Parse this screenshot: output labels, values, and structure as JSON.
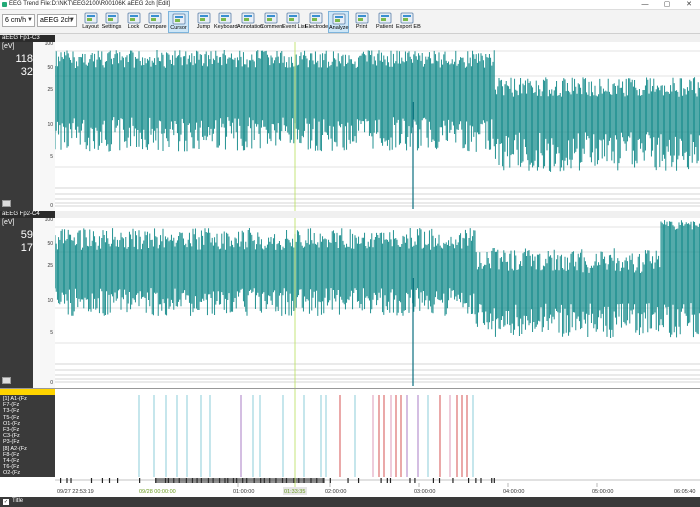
{
  "window": {
    "title": "EEG Trend File:D:\\NKT\\EEG2100\\R00106K aEEG 2ch [Edit]",
    "controls": [
      "—",
      "▢",
      "✕"
    ]
  },
  "toolbar": {
    "speed_select": "6 cm/h",
    "montage_select": "aEEG 2ch",
    "buttons": [
      {
        "label": "Layout",
        "icon": "layout-icon"
      },
      {
        "label": "Settings",
        "icon": "settings-icon"
      },
      {
        "label": "Lock",
        "icon": "lock-icon"
      },
      {
        "label": "Compare",
        "icon": "compare-icon"
      },
      {
        "label": "Cursor",
        "icon": "cursor-icon",
        "active": true
      },
      {
        "label": "Jump",
        "icon": "jump-icon"
      },
      {
        "label": "Keyboard",
        "icon": "keyboard-icon"
      },
      {
        "label": "Annotation",
        "icon": "annotation-icon"
      },
      {
        "label": "Comment",
        "icon": "comment-icon"
      },
      {
        "label": "Event List",
        "icon": "event-list-icon"
      },
      {
        "label": "Electrode",
        "icon": "electrode-icon"
      },
      {
        "label": "Analyze",
        "icon": "analyze-icon",
        "active": true
      },
      {
        "label": "Print",
        "icon": "print-icon"
      },
      {
        "label": "Patient",
        "icon": "patient-icon"
      },
      {
        "label": "Export EB",
        "icon": "export-icon"
      }
    ]
  },
  "channels": [
    {
      "name": "aEEG Fp1-C3",
      "unit": "[eV]",
      "upper_value": "118",
      "lower_value": "32",
      "scale_ticks": [
        "100",
        "50",
        "25",
        "10",
        "5",
        "0"
      ]
    },
    {
      "name": "aEEG Fp2-C4",
      "unit": "[eV]",
      "upper_value": "59",
      "lower_value": "17",
      "scale_ticks": [
        "100",
        "50",
        "25",
        "10",
        "5",
        "0"
      ]
    }
  ],
  "events": {
    "header": "",
    "labels": [
      "[1] A1-(Fz",
      "F7-(Fz",
      "T3-(Fz",
      "T5-(Fz",
      "O1-(Fz",
      "F3-(Fz",
      "C3-(Fz",
      "P3-(Fz",
      "[8] A2-(Fz",
      "F8-(Fz",
      "T4-(Fz",
      "T6-(Fz",
      "O2-(Fz"
    ],
    "colors": {
      "cyan": "#7fc9d6",
      "purple": "#a070c0",
      "pink": "#d98fb0",
      "red": "#d04040"
    }
  },
  "timeline": {
    "start_label": "09/27 22:53:19",
    "cursor_label": "09/28 00:00:00",
    "marker_label": "01:33:35",
    "ticks": [
      "01:00:00",
      "02:00:00",
      "03:00:00",
      "04:00:00",
      "05:00:00",
      "06:05:40"
    ]
  },
  "statusbar": {
    "title_label": "Title",
    "checked": true
  },
  "colors": {
    "trace": "#0a8585",
    "cursor": "#b8e05a",
    "grid": "#c8c8c8"
  }
}
